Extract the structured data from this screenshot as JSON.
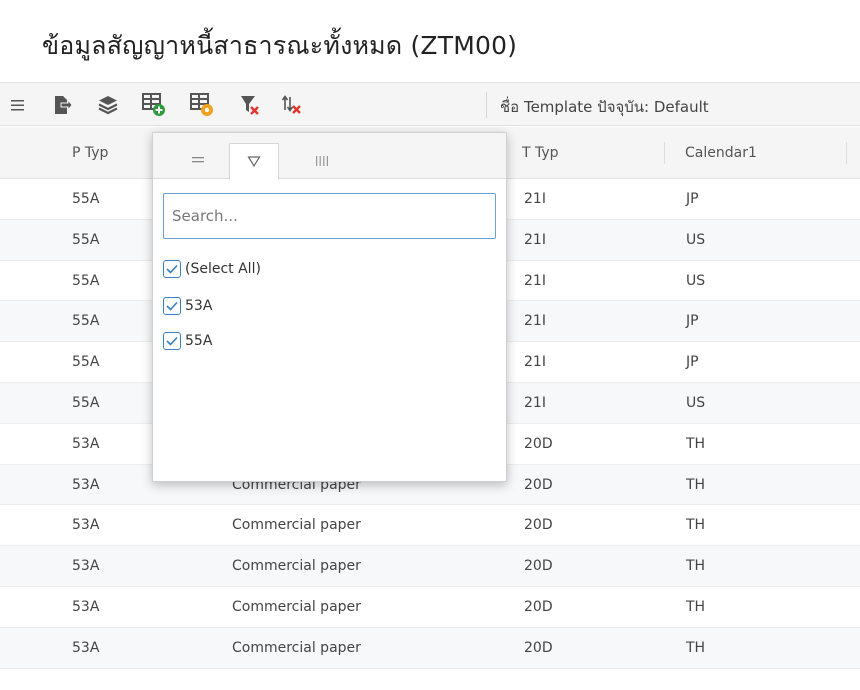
{
  "page_title": "ข้อมูลสัญญาหนี้สาธารณะทั้งหมด (ZTM00)",
  "toolbar": {
    "template_label": "ชื่อ Template ปัจจุบัน: Default",
    "buttons": [
      "menu-icon",
      "export-icon",
      "layers-icon",
      "add-table-icon",
      "edit-table-icon",
      "clear-filter-icon",
      "clear-sort-icon"
    ]
  },
  "columns": {
    "p_typ": "P Typ",
    "t_typ": "T Typ",
    "calendar1": "Calendar1"
  },
  "rows": [
    {
      "p_typ": "55A",
      "desc": "",
      "t_typ": "21I",
      "cal": "JP"
    },
    {
      "p_typ": "55A",
      "desc": "",
      "t_typ": "21I",
      "cal": "US"
    },
    {
      "p_typ": "55A",
      "desc": "",
      "t_typ": "21I",
      "cal": "US"
    },
    {
      "p_typ": "55A",
      "desc": "",
      "t_typ": "21I",
      "cal": "JP"
    },
    {
      "p_typ": "55A",
      "desc": "",
      "t_typ": "21I",
      "cal": "JP"
    },
    {
      "p_typ": "55A",
      "desc": "",
      "t_typ": "21I",
      "cal": "US"
    },
    {
      "p_typ": "53A",
      "desc": "",
      "t_typ": "20D",
      "cal": "TH"
    },
    {
      "p_typ": "53A",
      "desc": "Commercial paper",
      "t_typ": "20D",
      "cal": "TH"
    },
    {
      "p_typ": "53A",
      "desc": "Commercial paper",
      "t_typ": "20D",
      "cal": "TH"
    },
    {
      "p_typ": "53A",
      "desc": "Commercial paper",
      "t_typ": "20D",
      "cal": "TH"
    },
    {
      "p_typ": "53A",
      "desc": "Commercial paper",
      "t_typ": "20D",
      "cal": "TH"
    },
    {
      "p_typ": "53A",
      "desc": "Commercial paper",
      "t_typ": "20D",
      "cal": "TH"
    }
  ],
  "filter_popup": {
    "search_placeholder": "Search...",
    "search_value": "",
    "options": [
      {
        "label": "(Select All)",
        "checked": true
      },
      {
        "label": "53A",
        "checked": true
      },
      {
        "label": "55A",
        "checked": true
      }
    ]
  },
  "colors": {
    "accent": "#3b7fc4",
    "add_green": "#2e9b3a",
    "edit_orange": "#f0a21c",
    "clear_red": "#e0362c"
  }
}
